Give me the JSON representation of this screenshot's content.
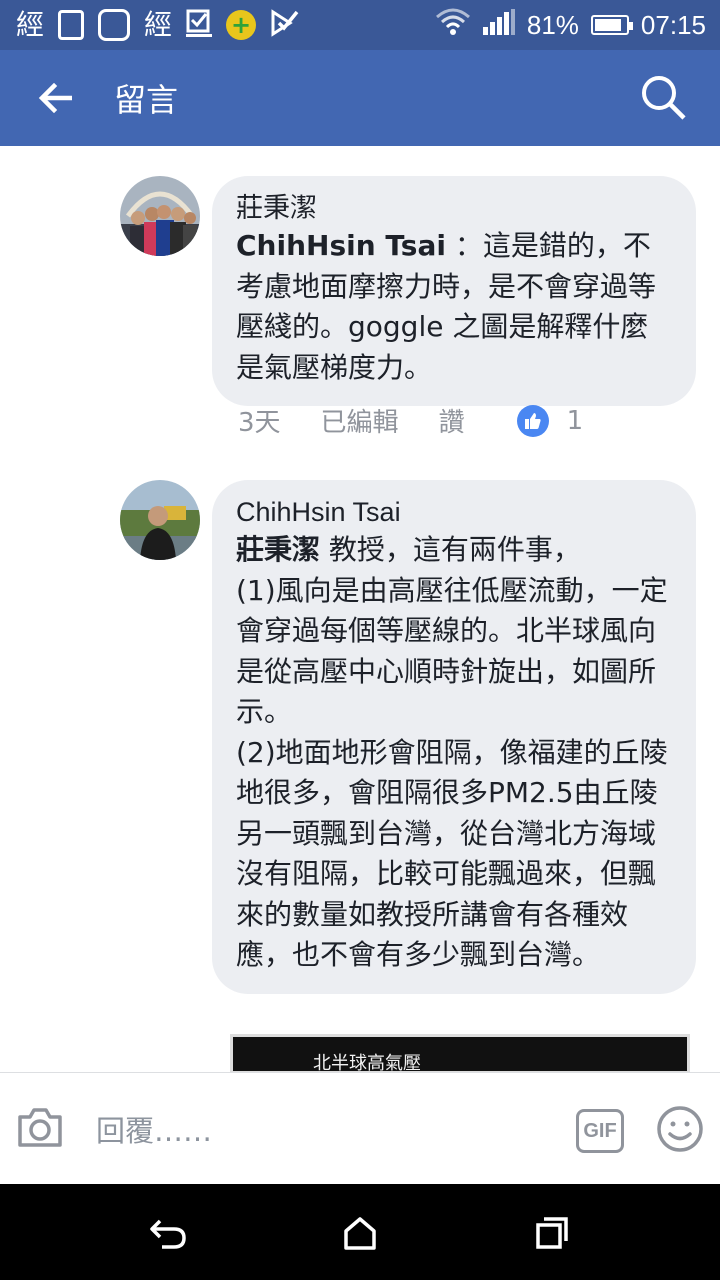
{
  "status_bar": {
    "left_icons": [
      "經",
      "經"
    ],
    "battery": "81%",
    "time": "07:15"
  },
  "app_bar": {
    "title": "留言"
  },
  "comments": [
    {
      "author": "莊秉潔",
      "mention": "ChihHsin Tsai",
      "text": " ：這是錯的，不考慮地面摩擦力時，是不會穿過等壓綫的。goggle 之圖是解釋什麼是氣壓梯度力。",
      "time": "3天",
      "edited": "已編輯",
      "like_label": "讚",
      "like_count": "1"
    },
    {
      "author": "ChihHsin Tsai",
      "mention": "莊秉潔",
      "text": " 教授，這有兩件事，\n(1)風向是由高壓往低壓流動，一定會穿過每個等壓線的。北半球風向是從高壓中心順時針旋出，如圖所示。\n(2)地面地形會阻隔，像福建的丘陵地很多，會阻隔很多PM2.5由丘陵另一頭飄到台灣，從台灣北方海域沒有阻隔，比較可能飄過來，但飄來的數量如教授所講會有各種效應，也不會有多少飄到台灣。"
    }
  ],
  "attachment": {
    "caption": "北半球高氣壓"
  },
  "reply_bar": {
    "placeholder": "回覆……",
    "gif_label": "GIF"
  },
  "colors": {
    "app_bar": "#4267b2",
    "status_bar": "#3a5897",
    "bubble": "#eceef2",
    "like": "#4a87f2"
  }
}
